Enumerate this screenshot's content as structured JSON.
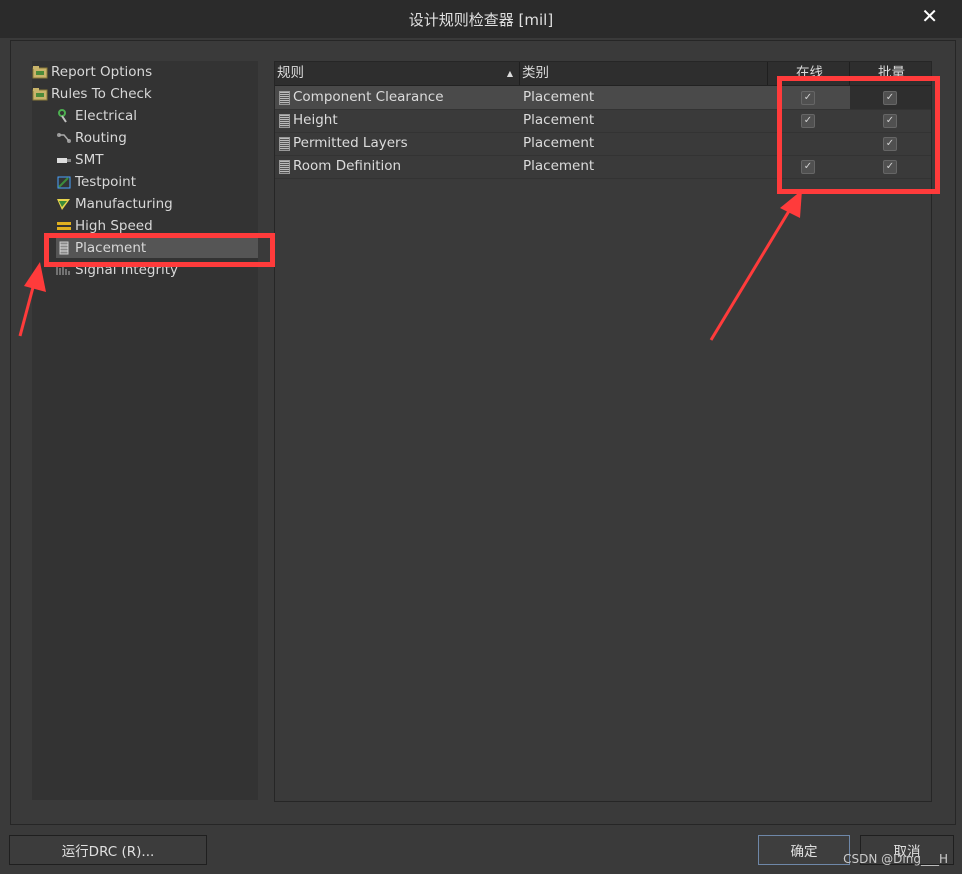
{
  "window": {
    "title": "设计规则检查器 [mil]",
    "close_label": "✕"
  },
  "tree": {
    "items": [
      {
        "label": "Report Options",
        "icon": "folder-icon"
      },
      {
        "label": "Rules To Check",
        "icon": "folder-icon"
      },
      {
        "label": "Electrical",
        "icon": "electrical-icon"
      },
      {
        "label": "Routing",
        "icon": "routing-icon"
      },
      {
        "label": "SMT",
        "icon": "smt-icon"
      },
      {
        "label": "Testpoint",
        "icon": "testpoint-icon"
      },
      {
        "label": "Manufacturing",
        "icon": "manufacturing-icon"
      },
      {
        "label": "High Speed",
        "icon": "high-speed-icon"
      },
      {
        "label": "Placement",
        "icon": "placement-icon",
        "selected": true
      },
      {
        "label": "Signal Integrity",
        "icon": "signal-integrity-icon"
      }
    ]
  },
  "grid": {
    "headers": {
      "rule": "规则",
      "category": "类别",
      "online": "在线",
      "batch": "批量"
    },
    "rows": [
      {
        "rule": "Component Clearance",
        "category": "Placement",
        "online": true,
        "batch": true
      },
      {
        "rule": "Height",
        "category": "Placement",
        "online": true,
        "batch": true
      },
      {
        "rule": "Permitted Layers",
        "category": "Placement",
        "online": false,
        "batch": true
      },
      {
        "rule": "Room Definition",
        "category": "Placement",
        "online": true,
        "batch": true
      }
    ]
  },
  "buttons": {
    "run_drc": "运行DRC (R)...",
    "ok": "确定",
    "cancel": "取消"
  },
  "watermark": "CSDN @Ding___H",
  "annotation_color": "#ff3b3b"
}
